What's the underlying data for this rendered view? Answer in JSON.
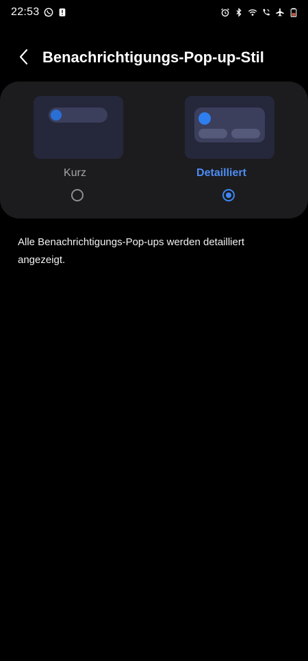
{
  "status_bar": {
    "time": "22:53",
    "left_icons": [
      "whatsapp-icon",
      "alert-icon"
    ],
    "right_icons": [
      "alarm-icon",
      "bluetooth-icon",
      "wifi-icon",
      "wifi-calling-icon",
      "airplane-icon",
      "battery-icon"
    ]
  },
  "header": {
    "back_icon": "chevron-left-icon",
    "title": "Benachrichtigungs-Pop-up-Stil"
  },
  "options": [
    {
      "label": "Kurz",
      "selected": false
    },
    {
      "label": "Detailliert",
      "selected": true
    }
  ],
  "description": "Alle Benachrichtigungs-Pop-ups werden detailliert angezeigt.",
  "colors": {
    "background": "#000000",
    "card": "#1c1c1e",
    "accent": "#3d86f5",
    "unselected_label": "#a6a6a6"
  }
}
